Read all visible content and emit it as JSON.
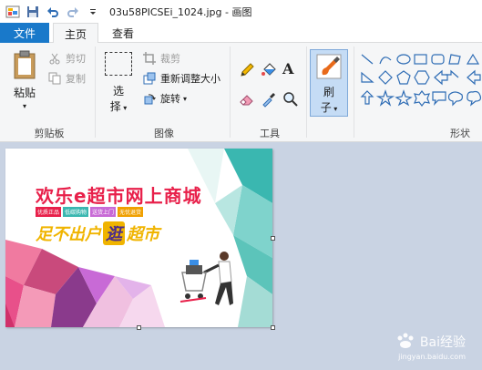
{
  "window": {
    "title": "03u58PICSEi_1024.jpg - 画图"
  },
  "tabs": {
    "file": "文件",
    "home": "主页",
    "view": "查看"
  },
  "clipboard": {
    "paste": "粘贴",
    "cut": "剪切",
    "copy": "复制",
    "group": "剪贴板"
  },
  "image": {
    "select_line1": "选",
    "select_line2": "择",
    "crop": "裁剪",
    "resize": "重新调整大小",
    "rotate": "旋转",
    "group": "图像"
  },
  "tools": {
    "group": "工具"
  },
  "brushes": {
    "line1": "刷",
    "line2": "子"
  },
  "shapes": {
    "group": "形状"
  },
  "picture": {
    "headline": "欢乐e超市网上商城",
    "badges": [
      "优质正品",
      "低碳购物",
      "送货上门",
      "无忧退货"
    ],
    "slogan_part1": "足不出户",
    "slogan_highlight": "逛",
    "slogan_part2": "超市"
  },
  "watermark": {
    "brand": "Bai经验",
    "url": "jingyan.baidu.com"
  },
  "colors": {
    "file_tab": "#1979ca",
    "ribbon": "#f5f6f7",
    "canvas_bg": "#c9d3e3",
    "headline": "#e8204a",
    "slogan": "#f0b400"
  }
}
